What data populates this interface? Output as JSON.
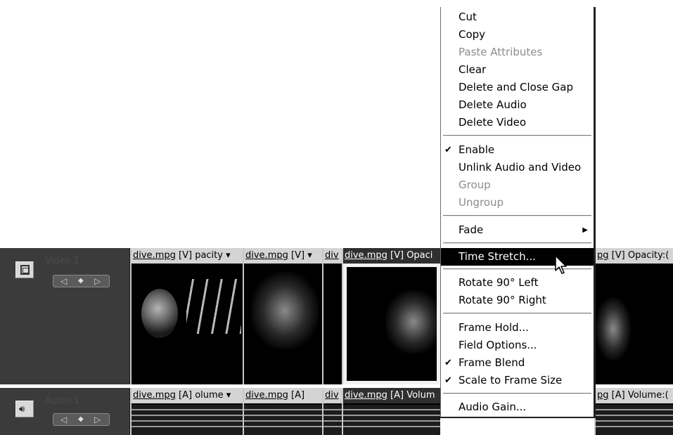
{
  "tracks": {
    "video": {
      "name": "Video 1",
      "icon": "film-icon"
    },
    "audio": {
      "name": "Audio 1",
      "icon": "speaker-icon"
    }
  },
  "video_clips": [
    {
      "name": "dive.mpg",
      "tag": "[V]",
      "param": "pacity ▾"
    },
    {
      "name": "dive.mpg",
      "tag": "[V]",
      "param": "▾"
    },
    {
      "name": "div",
      "tag": "",
      "param": ""
    },
    {
      "name": "dive.mpg",
      "tag": "[V]",
      "param": "Opaci"
    },
    {
      "name": "pg",
      "tag": "[V]",
      "param": "Opacity:("
    }
  ],
  "audio_clips": [
    {
      "name": "dive.mpg",
      "tag": "[A]",
      "param": "olume ▾"
    },
    {
      "name": "dive.mpg",
      "tag": "[A]",
      "param": ""
    },
    {
      "name": "div",
      "tag": "",
      "param": ""
    },
    {
      "name": "dive.mpg",
      "tag": "[A]",
      "param": "Volum"
    },
    {
      "name": "pg",
      "tag": "[A]",
      "param": "Volume:("
    }
  ],
  "keyframe_nav": {
    "prev": "◁",
    "add": "◆",
    "next": "▷"
  },
  "menu": {
    "items": [
      {
        "label": "Cut"
      },
      {
        "label": "Copy"
      },
      {
        "label": "Paste Attributes",
        "disabled": true
      },
      {
        "label": "Clear"
      },
      {
        "label": "Delete and Close Gap"
      },
      {
        "label": "Delete Audio"
      },
      {
        "label": "Delete Video"
      },
      {
        "label": "Enable",
        "checked": true
      },
      {
        "label": "Unlink Audio and Video"
      },
      {
        "label": "Group",
        "disabled": true
      },
      {
        "label": "Ungroup",
        "disabled": true
      },
      {
        "label": "Fade",
        "submenu": "▶"
      },
      {
        "label": "Time Stretch...",
        "highlighted": true
      },
      {
        "label": "Rotate 90° Left"
      },
      {
        "label": "Rotate 90° Right"
      },
      {
        "label": "Frame Hold..."
      },
      {
        "label": "Field Options..."
      },
      {
        "label": "Frame Blend",
        "checked": true
      },
      {
        "label": "Scale to Frame Size",
        "checked": true
      },
      {
        "label": "Audio Gain..."
      }
    ],
    "check_glyph": "✔"
  },
  "colors": {
    "track_header": "#3b3b3b",
    "clip_label": "#d4d4d4",
    "menu_highlight": "#000000"
  }
}
